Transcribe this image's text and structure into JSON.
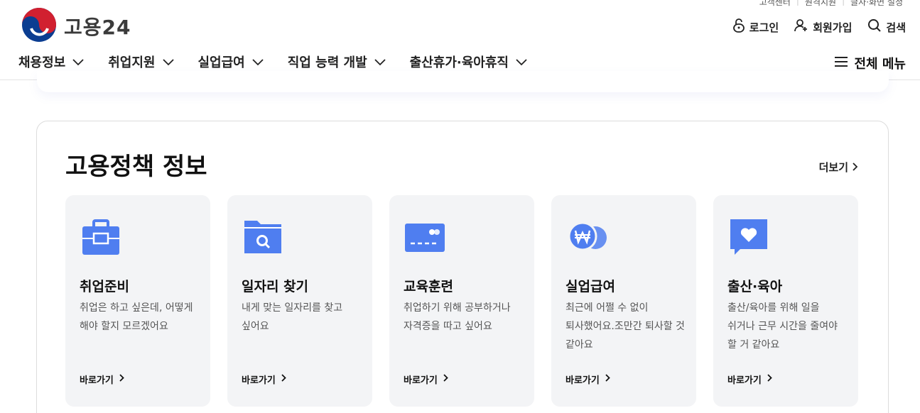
{
  "utility": [
    "고객센터",
    "원격지원",
    "글자·화면 설정"
  ],
  "logo": {
    "text": "고용24"
  },
  "top_actions": {
    "login": "로그인",
    "signup": "회원가입",
    "search": "검색"
  },
  "gnb": [
    "채용정보",
    "취업지원",
    "실업급여",
    "직업 능력 개발",
    "출산휴가·육아휴직"
  ],
  "all_menu": "전체 메뉴",
  "section": {
    "title": "고용정책 정보",
    "more": "더보기",
    "cards": [
      {
        "icon": "briefcase-icon",
        "title": "취업준비",
        "desc": "취업은 하고 싶은데, 어떻게 해야 할지 모르겠어요",
        "link": "바로가기"
      },
      {
        "icon": "folder-search-icon",
        "title": "일자리 찾기",
        "desc": "내게 맞는 일자리를 찾고 싶어요",
        "link": "바로가기"
      },
      {
        "icon": "card-icon",
        "title": "교육훈련",
        "desc": "취업하기 위해 공부하거나 자격증을 따고 싶어요",
        "link": "바로가기"
      },
      {
        "icon": "won-coin-icon",
        "title": "실업급여",
        "desc": "최근에 어쩔 수 없이 퇴사했어요.조만간 퇴사할 것 같아요",
        "link": "바로가기"
      },
      {
        "icon": "heart-chat-icon",
        "title": "출산·육아",
        "desc": "출산/육아를 위해 일을 쉬거나 근무 시간을 줄여야 할 거 같아요",
        "link": "바로가기"
      }
    ]
  },
  "colors": {
    "accent": "#4f7ef0",
    "card_bg": "#f3f4f6"
  }
}
